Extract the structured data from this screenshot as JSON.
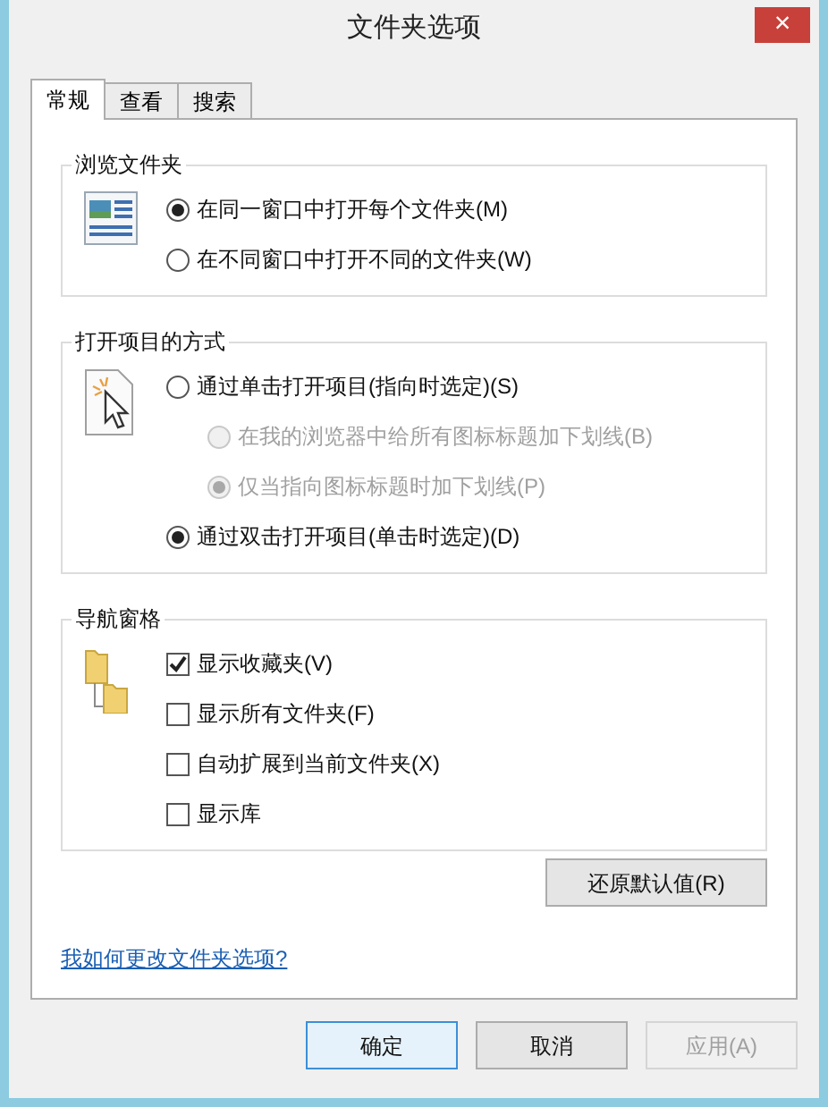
{
  "window": {
    "title": "文件夹选项",
    "close": "×"
  },
  "tabs": [
    {
      "label": "常规",
      "selected": true
    },
    {
      "label": "查看",
      "selected": false
    },
    {
      "label": "搜索",
      "selected": false
    }
  ],
  "groups": [
    {
      "title": "浏览文件夹",
      "options": [
        {
          "kind": "radio",
          "label": "在同一窗口中打开每个文件夹(M)",
          "checked": true,
          "disabled": false
        },
        {
          "kind": "radio",
          "label": "在不同窗口中打开不同的文件夹(W)",
          "checked": false,
          "disabled": false
        }
      ]
    },
    {
      "title": "打开项目的方式",
      "options": [
        {
          "kind": "radio",
          "label": "通过单击打开项目(指向时选定)(S)",
          "checked": false,
          "disabled": false,
          "children": [
            {
              "kind": "radio",
              "label": "在我的浏览器中给所有图标标题加下划线(B)",
              "checked": false,
              "disabled": true
            },
            {
              "kind": "radio",
              "label": "仅当指向图标标题时加下划线(P)",
              "checked": true,
              "disabled": true
            }
          ]
        },
        {
          "kind": "radio",
          "label": "通过双击打开项目(单击时选定)(D)",
          "checked": true,
          "disabled": false
        }
      ]
    },
    {
      "title": "导航窗格",
      "options": [
        {
          "kind": "checkbox",
          "label": "显示收藏夹(V)",
          "checked": true,
          "disabled": false
        },
        {
          "kind": "checkbox",
          "label": "显示所有文件夹(F)",
          "checked": false,
          "disabled": false
        },
        {
          "kind": "checkbox",
          "label": "自动扩展到当前文件夹(X)",
          "checked": false,
          "disabled": false
        },
        {
          "kind": "checkbox",
          "label": "显示库",
          "checked": false,
          "disabled": false
        }
      ]
    }
  ],
  "restore_button": "还原默认值(R)",
  "help_link": "我如何更改文件夹选项?",
  "buttons": [
    {
      "label": "确定",
      "default": true,
      "disabled": false
    },
    {
      "label": "取消",
      "default": false,
      "disabled": false
    },
    {
      "label": "应用(A)",
      "default": false,
      "disabled": true
    }
  ]
}
